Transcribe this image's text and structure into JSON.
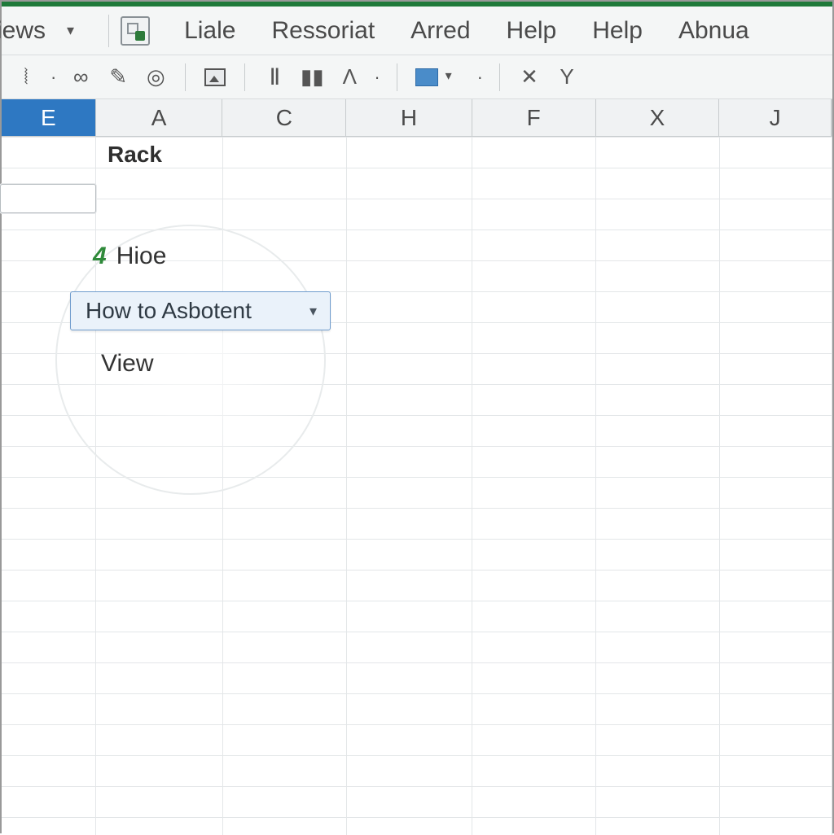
{
  "menubar": {
    "view_label": "iews",
    "items": [
      "Liale",
      "Ressoriat",
      "Arred",
      "Help",
      "Help",
      "Abnua"
    ]
  },
  "toolbar": {
    "glyphs": {
      "link": "∞",
      "pen": "✎",
      "bullseye": "◎",
      "ibeam": "Ⅱ",
      "rec": "▮▮",
      "lambda": "Λ",
      "x": "✕",
      "y": "Y"
    }
  },
  "columns": [
    "E",
    "A",
    "C",
    "H",
    "F",
    "X",
    "J"
  ],
  "selected_column": "E",
  "cells": {
    "A1": "Rack"
  },
  "callout": {
    "row_number": "4",
    "row_label": "Hioe",
    "dropdown_label": "How to Asbotent",
    "view_label": "View"
  }
}
